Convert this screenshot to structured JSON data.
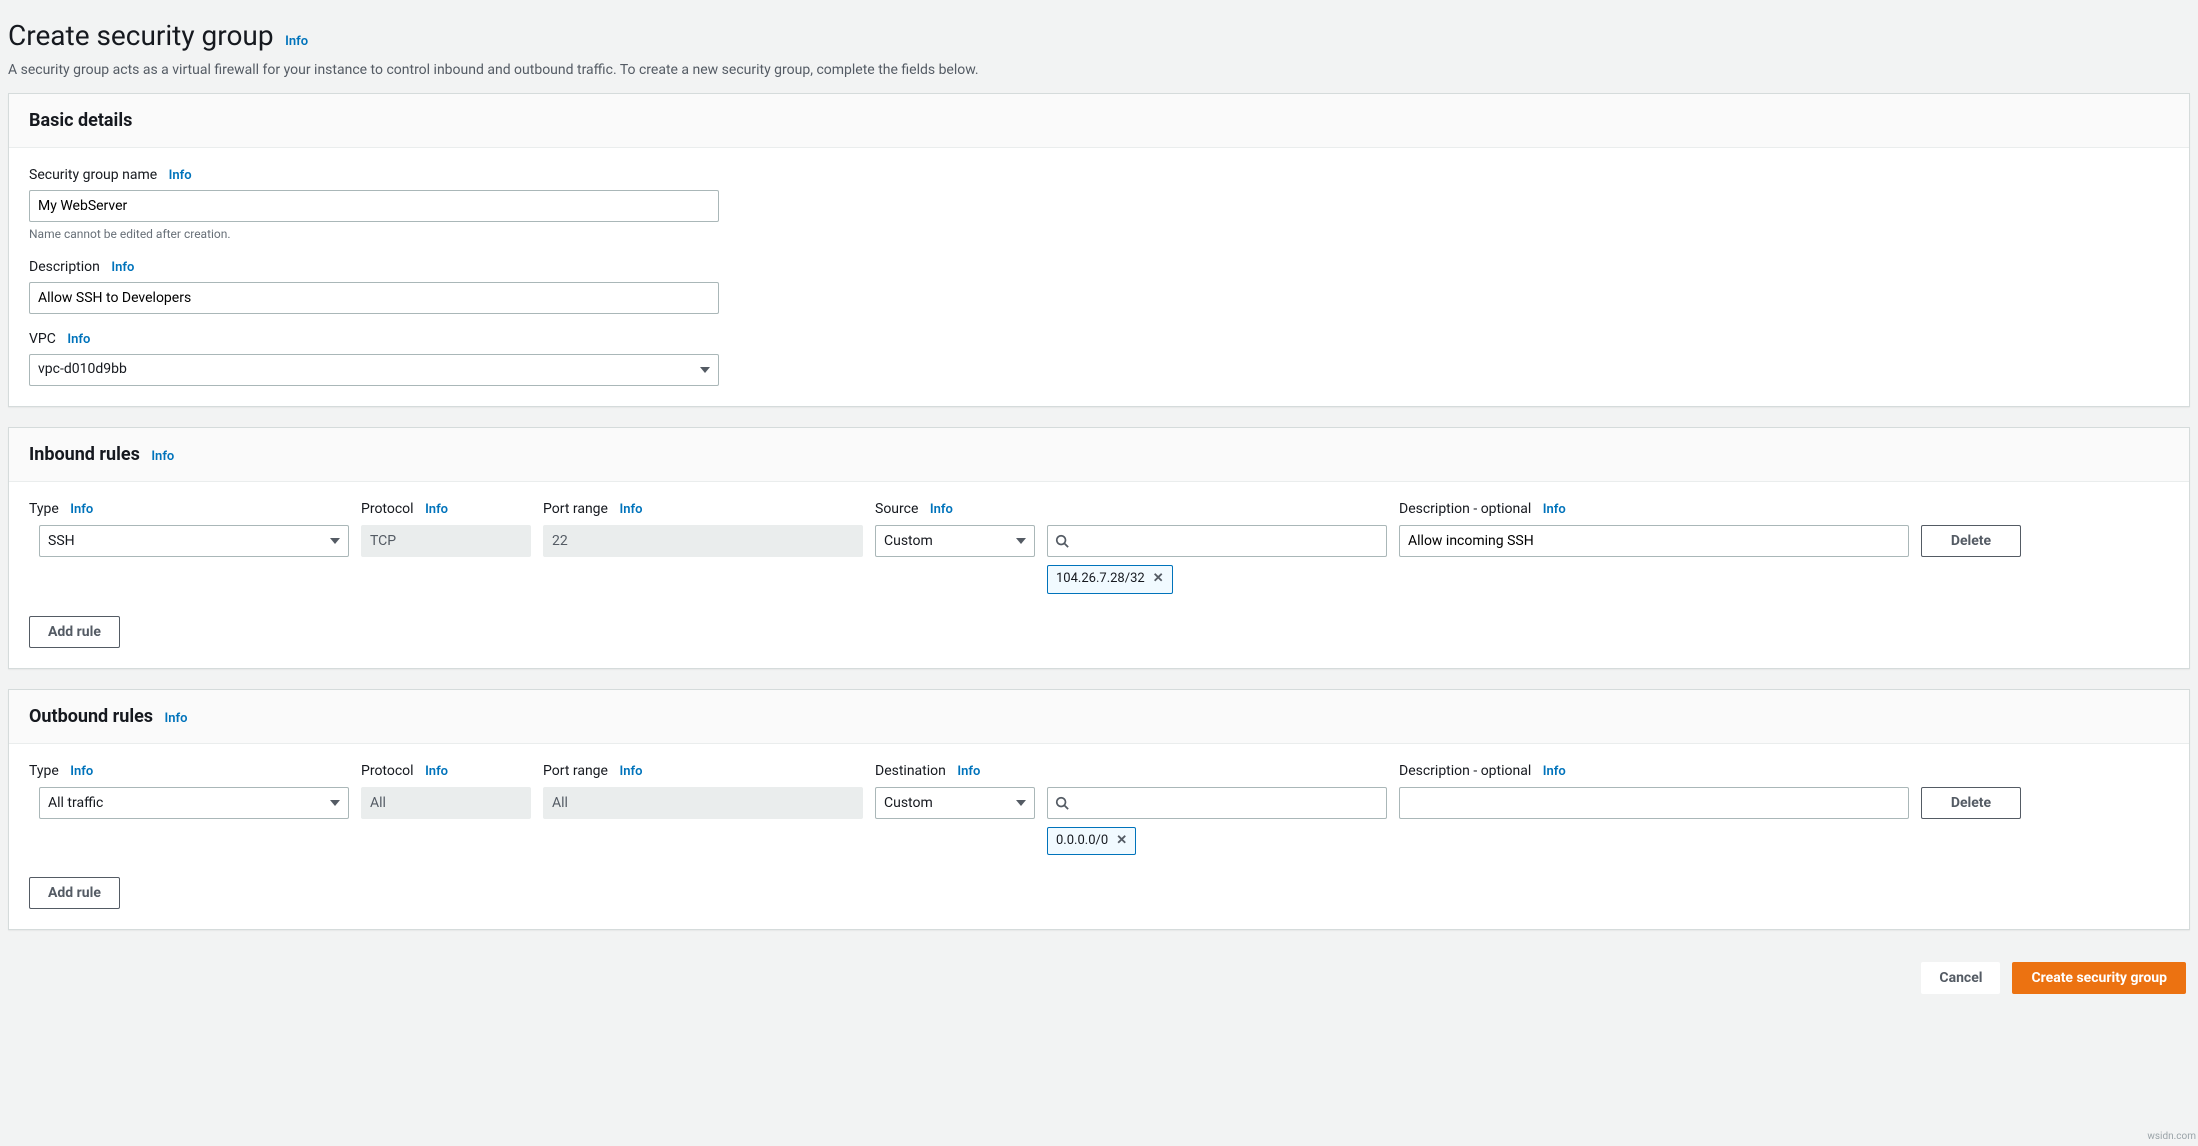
{
  "page": {
    "title": "Create security group",
    "info": "Info",
    "subtitle": "A security group acts as a virtual firewall for your instance to control inbound and outbound traffic. To create a new security group, complete the fields below."
  },
  "basic": {
    "title": "Basic details",
    "name_label": "Security group name",
    "name_value": "My WebServer",
    "name_hint": "Name cannot be edited after creation.",
    "desc_label": "Description",
    "desc_value": "Allow SSH to Developers",
    "vpc_label": "VPC",
    "vpc_value": "vpc-d010d9bb"
  },
  "inbound": {
    "title": "Inbound rules",
    "cols": {
      "type": "Type",
      "protocol": "Protocol",
      "port": "Port range",
      "source": "Source",
      "description": "Description - optional"
    },
    "row": {
      "type": "SSH",
      "protocol": "TCP",
      "port": "22",
      "source_mode": "Custom",
      "source_search": "",
      "source_chips": [
        "104.26.7.28/32"
      ],
      "description": "Allow incoming SSH"
    },
    "delete_label": "Delete",
    "add_rule_label": "Add rule"
  },
  "outbound": {
    "title": "Outbound rules",
    "cols": {
      "type": "Type",
      "protocol": "Protocol",
      "port": "Port range",
      "dest": "Destination",
      "description": "Description - optional"
    },
    "row": {
      "type": "All traffic",
      "protocol": "All",
      "port": "All",
      "dest_mode": "Custom",
      "dest_search": "",
      "dest_chips": [
        "0.0.0.0/0"
      ],
      "description": ""
    },
    "delete_label": "Delete",
    "add_rule_label": "Add rule"
  },
  "footer": {
    "cancel": "Cancel",
    "create": "Create security group"
  },
  "watermark": "wsidn.com"
}
